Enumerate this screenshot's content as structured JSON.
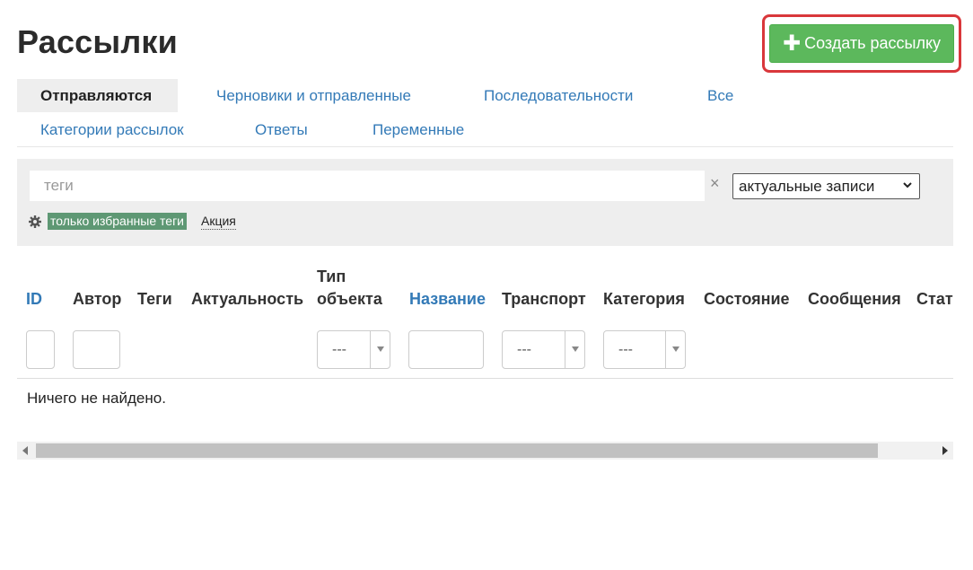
{
  "page": {
    "title": "Рассылки"
  },
  "actions": {
    "create_label": "Создать рассылку",
    "create_icon": "plus-icon"
  },
  "tabs": [
    {
      "label": "Отправляются",
      "active": true
    },
    {
      "label": "Черновики и отправленные",
      "active": false
    },
    {
      "label": "Последовательности",
      "active": false
    },
    {
      "label": "Все",
      "active": false
    },
    {
      "label": "Категории рассылок",
      "active": false
    },
    {
      "label": "Ответы",
      "active": false
    },
    {
      "label": "Переменные",
      "active": false
    }
  ],
  "filters": {
    "tags_placeholder": "теги",
    "tags_value": "",
    "clear_icon": "×",
    "records_select": "актуальные записи",
    "favorite_tags_label": "только избранные теги",
    "tags": [
      "Акция"
    ]
  },
  "table": {
    "columns": [
      {
        "label": "ID",
        "sortable": true
      },
      {
        "label": "Автор",
        "sortable": false
      },
      {
        "label": "Теги",
        "sortable": false
      },
      {
        "label": "Актуальность",
        "sortable": false
      },
      {
        "label_line1": "Тип",
        "label_line2": "объекта",
        "sortable": false
      },
      {
        "label": "Название",
        "sortable": true
      },
      {
        "label": "Транспорт",
        "sortable": false
      },
      {
        "label": "Категория",
        "sortable": false
      },
      {
        "label": "Состояние",
        "sortable": false
      },
      {
        "label": "Сообщения",
        "sortable": false
      },
      {
        "label": "Стат",
        "sortable": false
      }
    ],
    "filter_selects": {
      "object_type": "---",
      "transport": "---",
      "category": "---"
    },
    "empty_message": "Ничего не найдено."
  },
  "colors": {
    "link": "#337ab7",
    "create_button": "#5cb85c",
    "highlight_border": "#d9373b",
    "favorite_tag_bg": "#5e9874"
  }
}
